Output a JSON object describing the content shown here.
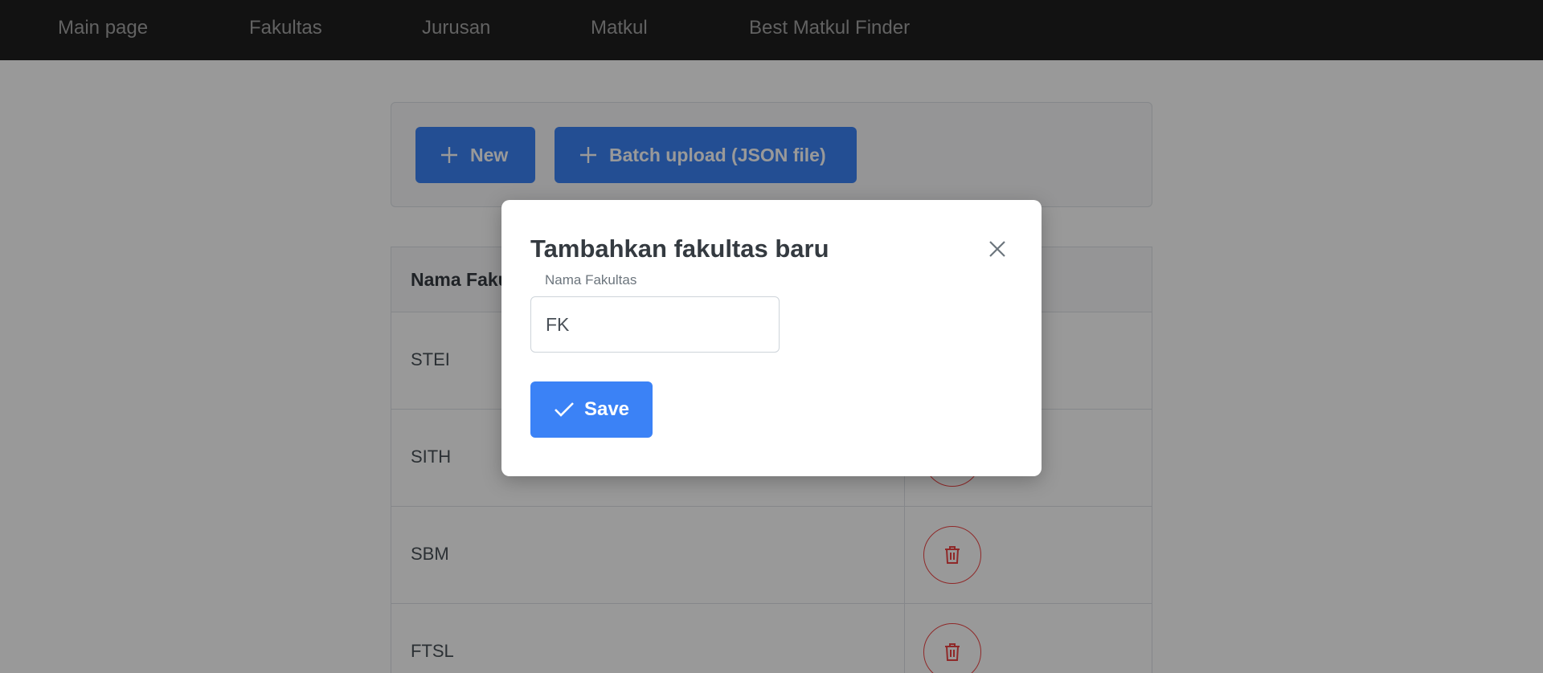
{
  "nav": {
    "items": [
      {
        "label": "Main page"
      },
      {
        "label": "Fakultas"
      },
      {
        "label": "Jurusan"
      },
      {
        "label": "Matkul"
      },
      {
        "label": "Best Matkul Finder"
      }
    ]
  },
  "toolbar": {
    "new_label": "New",
    "batch_label": "Batch upload (JSON file)"
  },
  "table": {
    "column_header": "Nama Fakultas",
    "rows": [
      {
        "name": "STEI"
      },
      {
        "name": "SITH"
      },
      {
        "name": "SBM"
      },
      {
        "name": "FTSL"
      }
    ]
  },
  "modal": {
    "title": "Tambahkan fakultas baru",
    "field_label": "Nama Fakultas",
    "field_value": "FK",
    "save_label": "Save"
  },
  "icons": {
    "plus": "plus-icon",
    "trash": "trash-icon",
    "close": "close-icon",
    "check": "check-icon"
  },
  "colors": {
    "primary": "#3b82f6",
    "danger": "#ef4444",
    "navbar_bg": "#1e1e1e"
  }
}
